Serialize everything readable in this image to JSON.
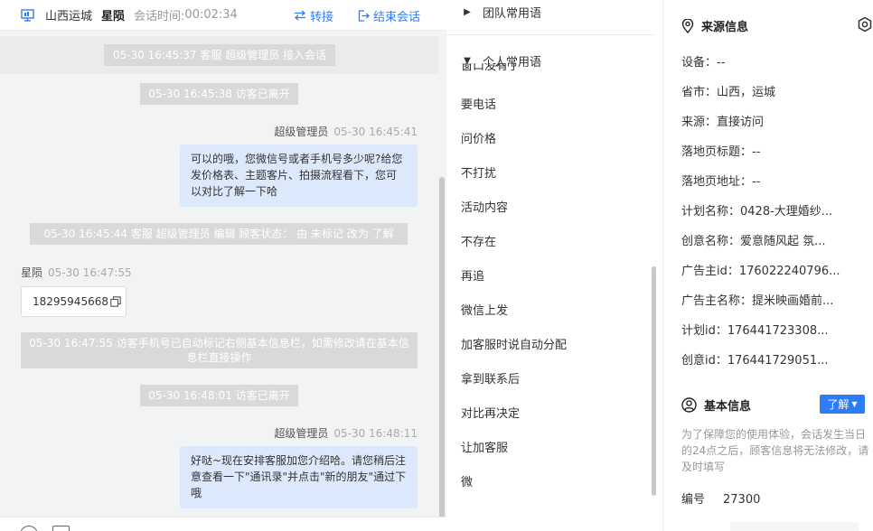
{
  "header": {
    "location": "山西运城",
    "visitor_name": "星陨",
    "session_time_label": "会话时间:",
    "session_time": "00:02:34",
    "transfer_label": "转接",
    "end_label": "结束会话"
  },
  "messages": {
    "sys1": "05-30 16:45:37 客服 超级管理员 接入会话",
    "sys2": "05-30 16:45:38 访客已离开",
    "agent1_sender": "超级管理员",
    "agent1_time": "05-30 16:45:41",
    "agent1_text": "可以的哦，您微信号或者手机号多少呢?给您发价格表、主题客片、拍摄流程看下，您可以对比了解一下哈",
    "sys3": "05-30 16:45:44 客服 超级管理员 编辑 顾客状态： 由 未标记 改为 了解",
    "visitor1_sender": "星陨",
    "visitor1_time": "05-30 16:47:55",
    "visitor1_text": "18295945668",
    "sys4": "05-30 16:47:55 访客手机号已自动标记右侧基本信息栏，如需修改请在基本信息栏直接操作",
    "sys5": "05-30 16:48:01 访客已离开",
    "agent2_sender": "超级管理员",
    "agent2_time": "05-30 16:48:11",
    "agent2_text": "好哒~现在安排客服加您介绍哈。请您稍后注意查看一下\"通讯录\"并点击\"新的朋友\"通过下哦"
  },
  "phrases": {
    "team_group": "团队常用语",
    "personal_group": "个人常用语",
    "clipped_item": "窗口没有了",
    "items": [
      "要电话",
      "问价格",
      "不打扰",
      "活动内容",
      "不存在",
      "再追",
      "微信上发",
      "加客服时说自动分配",
      "拿到联系后",
      "对比再决定",
      "让加客服",
      "微"
    ]
  },
  "source_info": {
    "title": "来源信息",
    "rows": [
      "设备：--",
      "省市：山西，运城",
      "来源：直接访问",
      "落地页标题：--",
      "落地页地址：--",
      "计划名称：0428-大理婚纱...",
      "创意名称：爱意随风起 氛...",
      "广告主id：176022240796...",
      "广告主名称：提米映画婚前...",
      "计划id：176441723308...",
      "创意id：176441729051..."
    ]
  },
  "basic_info": {
    "title": "基本信息",
    "status_button": "了解",
    "notice": "为了保障您的使用体验，会话发生当日的24点之后，顾客信息将无法修改，请及时填写",
    "id_label": "编号",
    "id_value": "27300"
  },
  "colors": {
    "accent": "#2f7df6",
    "agent_bubble": "#dce8fb",
    "system_message": "#d9d9d9",
    "chat_background": "#f2f3f5"
  }
}
